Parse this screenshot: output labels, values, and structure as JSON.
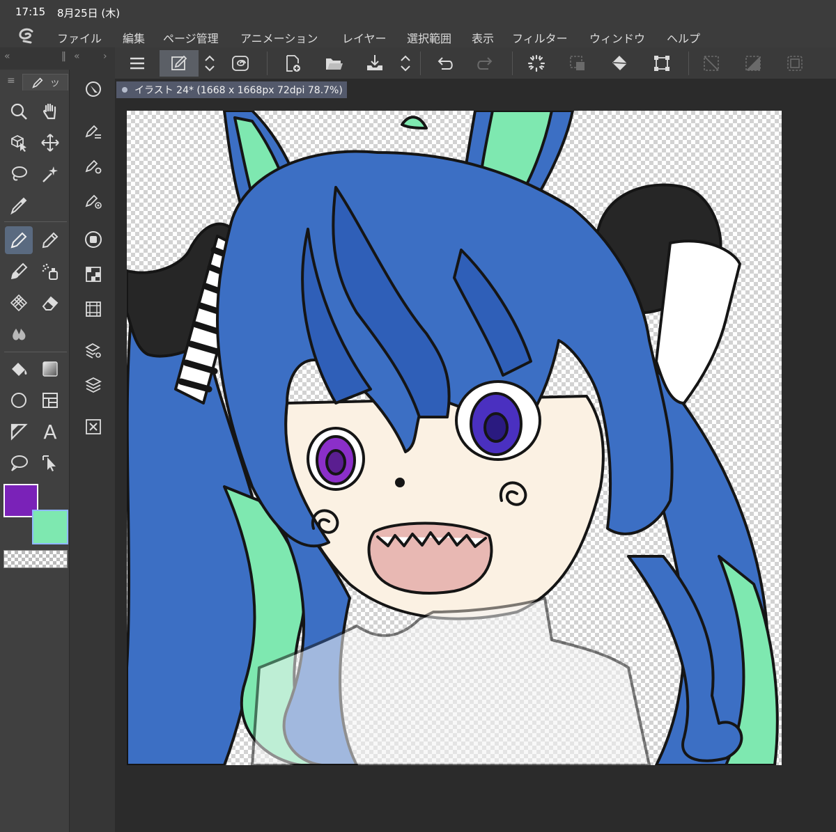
{
  "status": {
    "time": "17:15",
    "date": "8月25日 (木)"
  },
  "menu": {
    "items": [
      {
        "label": "ファイル"
      },
      {
        "label": "編集"
      },
      {
        "label": "ページ管理"
      },
      {
        "label": "アニメーション"
      },
      {
        "label": "レイヤー"
      },
      {
        "label": "選択範囲"
      },
      {
        "label": "表示"
      },
      {
        "label": "フィルター"
      },
      {
        "label": "ウィンドウ"
      },
      {
        "label": "ヘルプ"
      }
    ]
  },
  "tool_panel": {
    "tab_label": "ツ"
  },
  "colors": {
    "main": "#7a22b8",
    "sub": "#7ee8b0",
    "accent": "#5a6a80"
  },
  "document": {
    "tab_title": "イラスト 24* (1668 x 1668px 72dpi 78.7%)"
  },
  "tools": [
    {
      "name": "zoom-tool",
      "icon": "magnifier-icon"
    },
    {
      "name": "hand-tool",
      "icon": "hand-icon"
    },
    {
      "name": "object-tool",
      "icon": "cube-cursor-icon"
    },
    {
      "name": "move-tool",
      "icon": "move-arrows-icon"
    },
    {
      "name": "lasso-tool",
      "icon": "lasso-icon"
    },
    {
      "name": "magic-wand-tool",
      "icon": "magic-wand-icon"
    },
    {
      "name": "eyedropper-tool",
      "icon": "eyedropper-icon"
    },
    {
      "name": "pen-tool",
      "icon": "pen-icon",
      "active": true
    },
    {
      "name": "pencil-tool",
      "icon": "pencil-icon"
    },
    {
      "name": "brush-tool",
      "icon": "brush-icon"
    },
    {
      "name": "airbrush-tool",
      "icon": "airbrush-icon"
    },
    {
      "name": "decoration-tool",
      "icon": "decoration-icon"
    },
    {
      "name": "eraser-tool",
      "icon": "eraser-icon"
    },
    {
      "name": "blend-tool",
      "icon": "blend-icon"
    },
    {
      "name": "fill-tool",
      "icon": "bucket-icon"
    },
    {
      "name": "gradient-tool",
      "icon": "gradient-icon"
    },
    {
      "name": "figure-tool",
      "icon": "circle-icon"
    },
    {
      "name": "frame-tool",
      "icon": "frame-icon"
    },
    {
      "name": "ruler-tool",
      "icon": "ruler-icon"
    },
    {
      "name": "text-tool",
      "icon": "text-icon"
    },
    {
      "name": "balloon-tool",
      "icon": "balloon-icon"
    },
    {
      "name": "correct-line-tool",
      "icon": "correct-line-icon"
    }
  ],
  "text_tool_glyph": "A"
}
